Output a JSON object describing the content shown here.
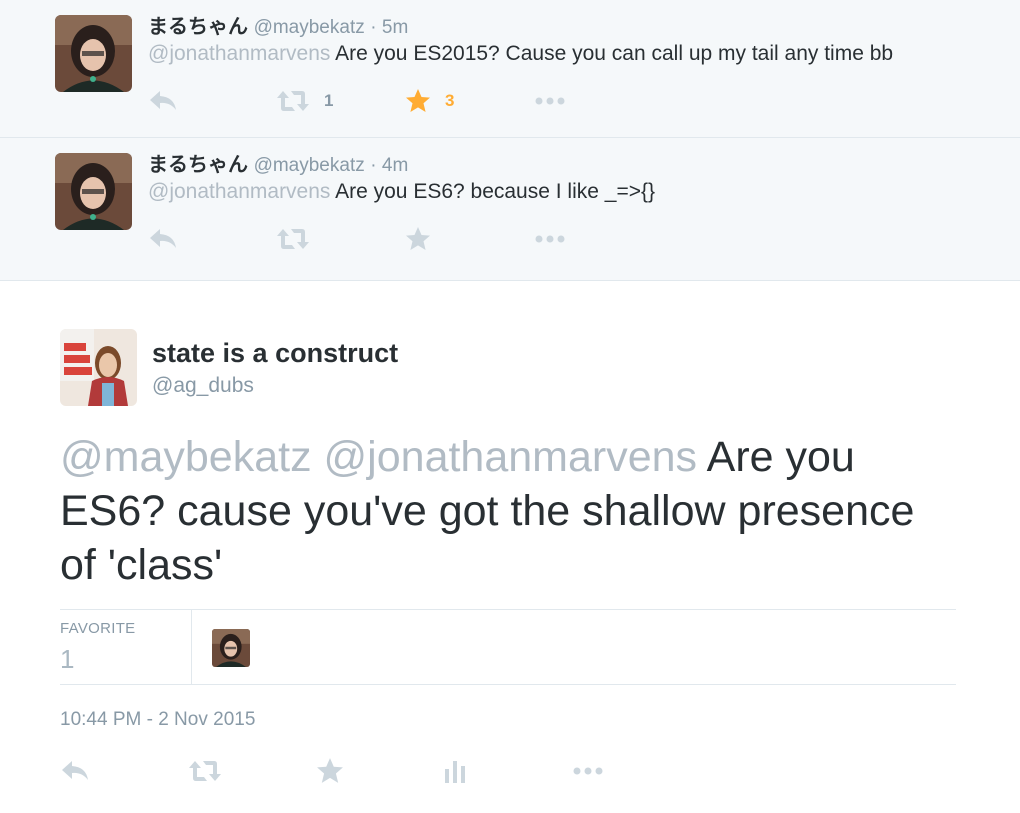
{
  "replies": [
    {
      "fullname": "まるちゃん",
      "screenname": "@maybekatz",
      "time": "· 5m",
      "mention": "@jonathanmarvens",
      "text": "Are you ES2015? Cause you can call up my tail any time bb",
      "retweet_count": "1",
      "favorite_count": "3",
      "favorited": true
    },
    {
      "fullname": "まるちゃん",
      "screenname": "@maybekatz",
      "time": "· 4m",
      "mention": "@jonathanmarvens",
      "text": "Are you ES6? because I like _=>{}",
      "retweet_count": "",
      "favorite_count": "",
      "favorited": false
    }
  ],
  "main_tweet": {
    "fullname": "state is a construct",
    "screenname": "@ag_dubs",
    "mention_1": "@maybekatz",
    "mention_2": "@jonathanmarvens",
    "text": "Are you ES6? cause you've got the shallow presence of 'class'",
    "favorite_label": "FAVORITE",
    "favorite_count": "1",
    "timestamp": "10:44 PM - 2 Nov 2015"
  },
  "icons": [
    "reply-icon",
    "retweet-icon",
    "star-icon",
    "more-icon",
    "analytics-icon"
  ],
  "colors": {
    "gold_star": "#ffac33",
    "icon_grey": "#ccd6dd",
    "mention_grey": "#b1bbc4",
    "reply_background": "#f5f8fa"
  }
}
